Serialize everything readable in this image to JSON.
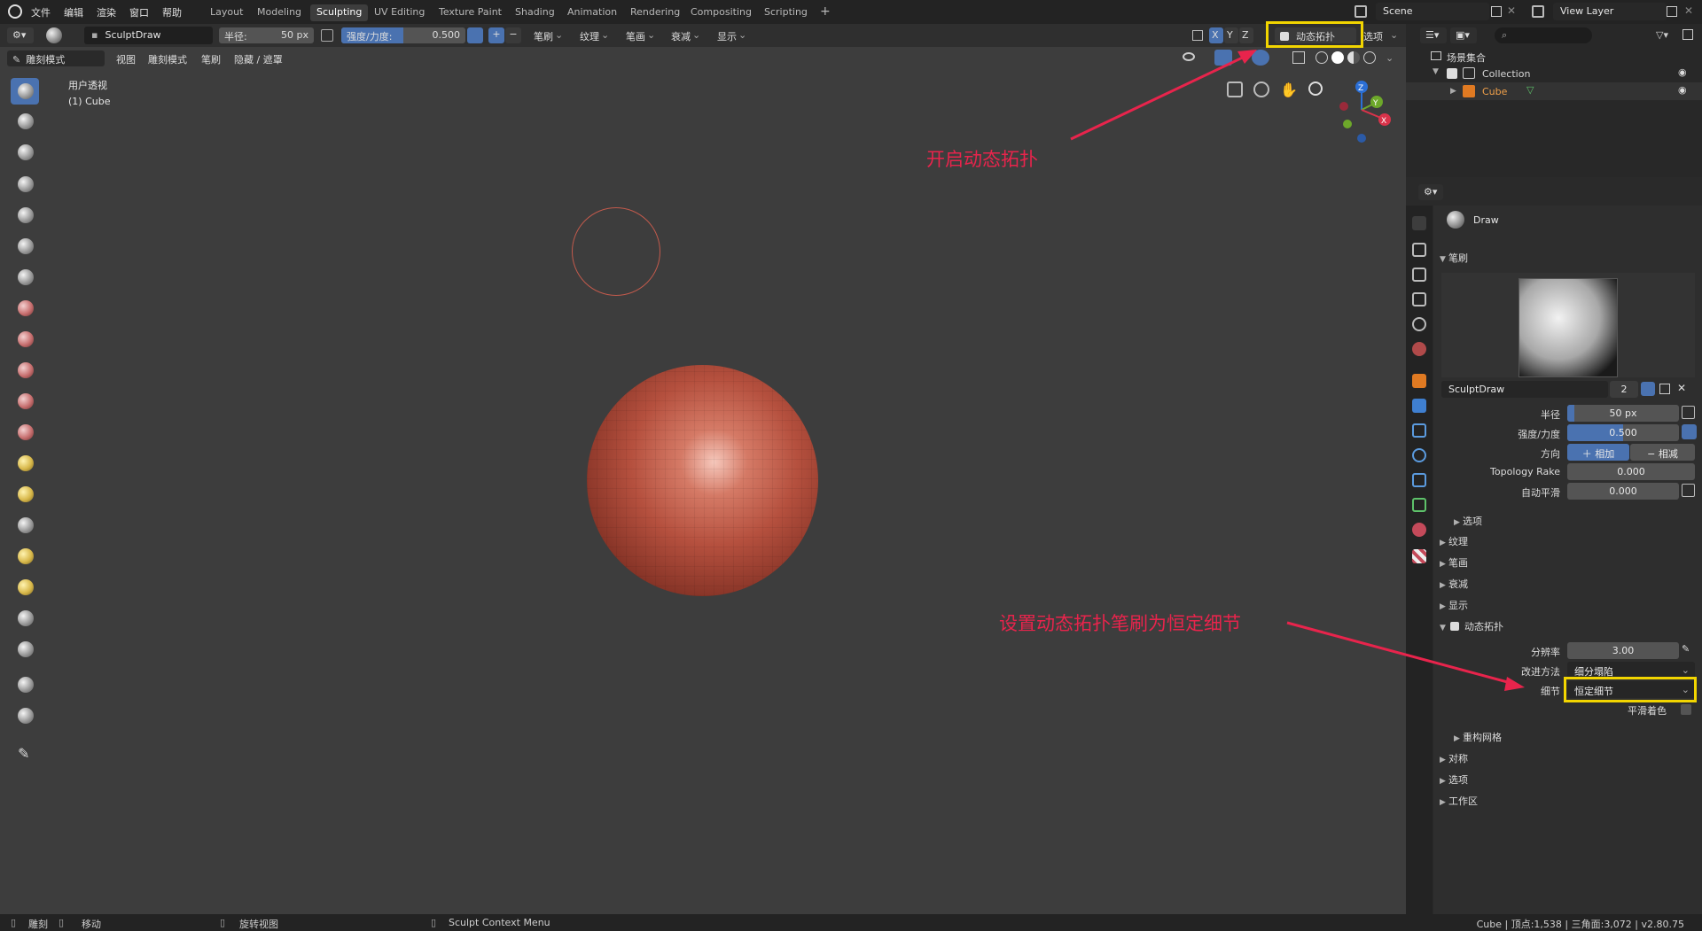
{
  "topbar": {
    "menus": [
      "文件",
      "编辑",
      "渲染",
      "窗口",
      "帮助"
    ],
    "workspaces": [
      "Layout",
      "Modeling",
      "Sculpting",
      "UV Editing",
      "Texture Paint",
      "Shading",
      "Animation",
      "Rendering",
      "Compositing",
      "Scripting"
    ],
    "active_workspace": "Sculpting",
    "add_tab": "+",
    "scene": "Scene",
    "view_layer": "View Layer"
  },
  "tool_header": {
    "brush_name": "SculptDraw",
    "radius_label": "半径:",
    "radius_value": "50 px",
    "strength_label": "强度/力度:",
    "strength_value": "0.500",
    "plus": "+",
    "minus": "−",
    "menus": [
      "笔刷",
      "纹理",
      "笔画",
      "衰减",
      "显示"
    ],
    "axes": [
      "X",
      "Y",
      "Z"
    ],
    "dyntopo": "动态拓扑",
    "options": "选项"
  },
  "viewport_header": {
    "mode": "雕刻模式",
    "menus": [
      "视图",
      "雕刻模式",
      "笔刷",
      "隐藏 / 遮罩"
    ]
  },
  "viewport": {
    "view_name": "用户透视",
    "object_name": "(1) Cube",
    "gizmo": [
      "Z",
      "Y",
      "X"
    ]
  },
  "outliner": {
    "scene_collection": "场景集合",
    "collection": "Collection",
    "object": "Cube"
  },
  "properties": {
    "tool_name": "Draw",
    "brush_section": "笔刷",
    "brush_datablock": "SculptDraw",
    "brush_users": "2",
    "radius_label": "半径",
    "radius_value": "50 px",
    "strength_label": "强度/力度",
    "strength_value": "0.500",
    "strength_fraction": 0.5,
    "direction_label": "方向",
    "direction_add": "相加",
    "direction_sub": "相减",
    "topology_rake_label": "Topology Rake",
    "topology_rake_value": "0.000",
    "autosmooth_label": "自动平滑",
    "autosmooth_value": "0.000",
    "sub_options": "选项",
    "texture": "纹理",
    "stroke": "笔画",
    "falloff": "衰减",
    "display": "显示",
    "dyntopo_section": "动态拓扑",
    "resolution_label": "分辨率",
    "resolution_value": "3.00",
    "refine_label": "改进方法",
    "refine_value": "细分塌陷",
    "detail_label": "细节",
    "detail_value": "恒定细节",
    "smooth_shading": "平滑着色",
    "remesh": "重构网格",
    "symmetry": "对称",
    "options": "选项",
    "workspace": "工作区"
  },
  "annotations": {
    "top": "开启动态拓扑",
    "bottom": "设置动态拓扑笔刷为恒定细节"
  },
  "statusbar": {
    "sculpt": "雕刻",
    "move": "移动",
    "rotate": "旋转视图",
    "context": "Sculpt Context Menu",
    "stats": "Cube | 顶点:1,538 | 三角面:3,072 | v2.80.75"
  },
  "colors": {
    "accent": "#4a72b0",
    "annotation": "#e8244c",
    "highlight_box": "#f2d500",
    "sphere": "#b5503e"
  }
}
